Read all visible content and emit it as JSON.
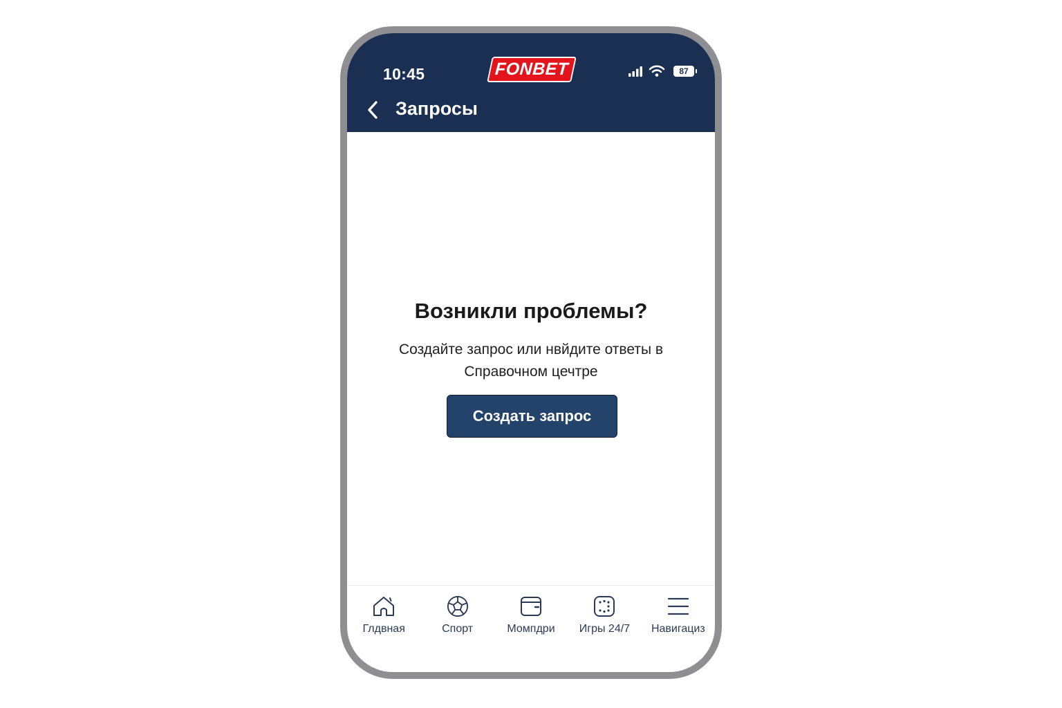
{
  "colors": {
    "brand_navy": "#1a2f52",
    "brand_red": "#e3141b",
    "accent": "#23436b"
  },
  "status_bar": {
    "time": "10:45",
    "battery": "87",
    "icons": [
      "signal-icon",
      "wifi-icon",
      "battery-icon"
    ]
  },
  "header": {
    "logo_text": "FONBET",
    "title": "Запросы",
    "back_icon": "chevron-left-icon"
  },
  "empty_state": {
    "title": "Возникли проблемы?",
    "description": "Создайте запрос или нвйдите ответы в Справочном цечтре",
    "button_label": "Создать запрос"
  },
  "tabbar": {
    "items": [
      {
        "label": "Глдвная",
        "icon": "home-icon"
      },
      {
        "label": "Спорт",
        "icon": "ball-icon"
      },
      {
        "label": "Момпдри",
        "icon": "wallet-icon"
      },
      {
        "label": "Игры 24/7",
        "icon": "dice-icon"
      },
      {
        "label": "Навигациз",
        "icon": "menu-icon"
      }
    ]
  }
}
